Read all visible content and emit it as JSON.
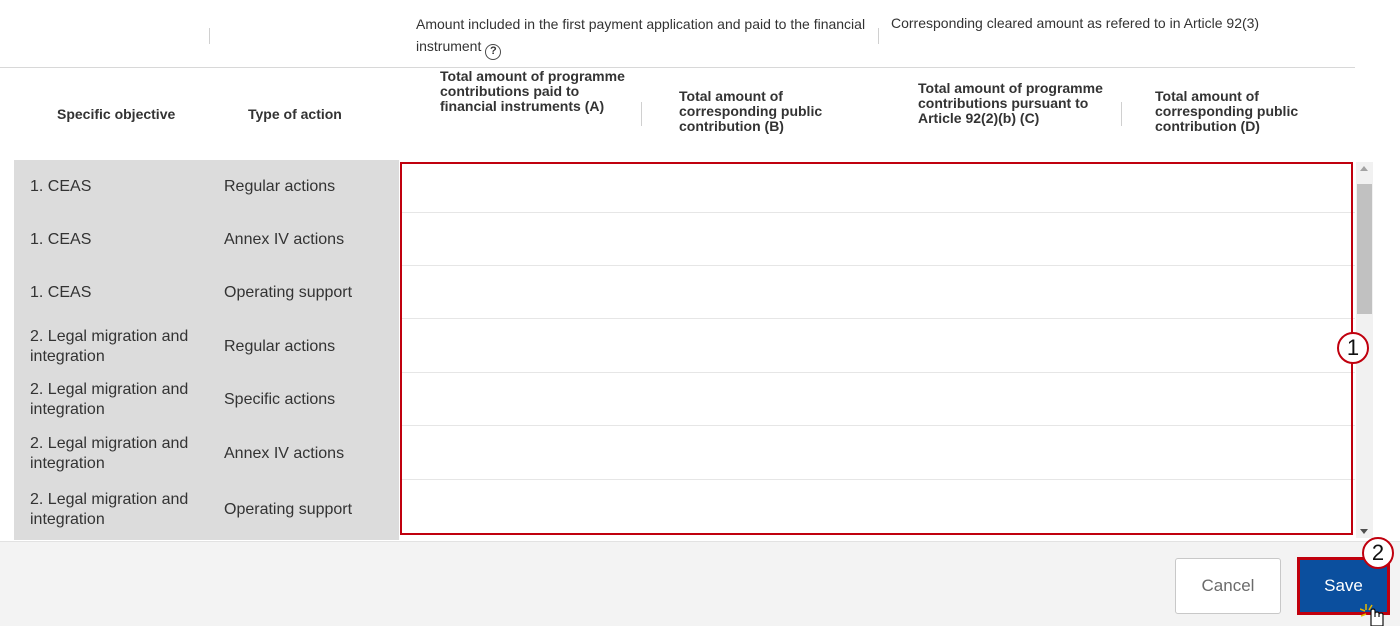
{
  "group_header": {
    "group_a": "Amount included in the first payment application and paid to the financial instrument",
    "group_b": "Corresponding cleared amount as refered to in Article 92(3)"
  },
  "columns": {
    "specific_objective": "Specific objective",
    "type_of_action": "Type of action",
    "col_a": "Total amount of programme contributions paid to financial instruments (A)",
    "col_b": "Total amount of corresponding public contribution (B)",
    "col_c": "Total amount of programme contributions pursuant to Article 92(2)(b) (C)",
    "col_d": "Total amount of corresponding public contribution (D)"
  },
  "rows": [
    {
      "objective": "1. CEAS",
      "type": "Regular actions"
    },
    {
      "objective": "1. CEAS",
      "type": "Annex IV actions"
    },
    {
      "objective": "1. CEAS",
      "type": "Operating support"
    },
    {
      "objective": "2. Legal migration and integration",
      "type": "Regular actions"
    },
    {
      "objective": "2. Legal migration and integration",
      "type": "Specific actions"
    },
    {
      "objective": "2. Legal migration and integration",
      "type": "Annex IV actions"
    },
    {
      "objective": "2. Legal migration and integration",
      "type": "Operating support"
    }
  ],
  "callouts": {
    "one": "1",
    "two": "2"
  },
  "footer": {
    "cancel_label": "Cancel",
    "save_label": "Save"
  },
  "icons": {
    "help": "help-circle-icon",
    "cursor": "hand-pointer-icon"
  },
  "colors": {
    "highlight": "#c0000e",
    "save_bg": "#0b4f9e",
    "row_label_bg": "#dcdcdc"
  }
}
